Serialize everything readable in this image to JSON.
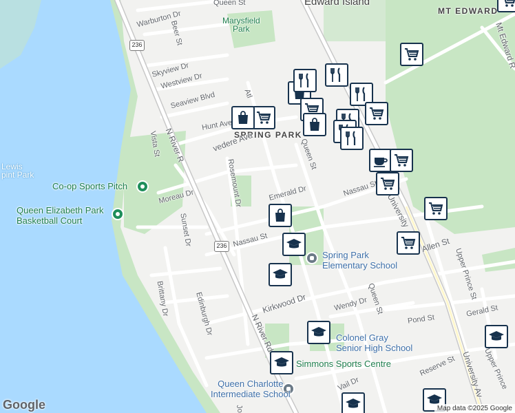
{
  "colors": {
    "water": "#aadaff",
    "park": "#c8e6c4",
    "road": "#ffffff",
    "highway": "#bcbcbc",
    "marker_border": "#17324d",
    "poi_green": "#1e7e4d",
    "poi_blue": "#3d6fa8"
  },
  "map_labels": {
    "edward_island": "Edward Island",
    "mt_edward": "MT EDWARD",
    "marysfield_park": "Marysfield\nPark",
    "spring_park": "SPRING PARK",
    "lewis_point_park": "Lewis\npint Park"
  },
  "streets": {
    "queen_top": "Queen St",
    "warburton": "Warburton Dr",
    "beer": "Beer St",
    "skyview": "Skyview Dr",
    "westview": "Westview Dr",
    "seaview": "Seaview Blvd",
    "hunt": "Hunt Ave",
    "atlantic": "Atl",
    "belvedere": "vedere Ave",
    "n_river_rd_1": "N River R",
    "vista": "Vista St",
    "rosemount": "Rosemount Dr",
    "moreau": "Moreau Dr",
    "emerald": "Emerald Dr",
    "queen_mid": "Queen St",
    "nassau_left": "Nassau St",
    "nassau_right": "Nassau St",
    "university_1": "University",
    "sunset": "Sunset Dr",
    "allen": "Allen St",
    "upper_prince_1": "Upper Prince St",
    "brittany": "Brittany Dr",
    "edinburgh": "Edinburgh Dr",
    "kirkwood": "Kirkwood Dr",
    "wendy": "Wendy Dr",
    "queen_low": "Queen St",
    "pond": "Pond St",
    "gerald": "Gerald St",
    "n_river_rd_2": "N River Rd",
    "university_2": "University Av",
    "upper_prince_2": "Upper Prince",
    "reserve": "Reserve St",
    "vail": "Vail Dr",
    "mt_edward_rd": "Mt Edward R",
    "sunset_lower": "Jo"
  },
  "route_shields": [
    "236",
    "236"
  ],
  "pois": {
    "coop": "Co-op Sports Pitch",
    "qe_park": "Queen Elizabeth Park\nBasketball Court",
    "spring_park_elem": "Spring Park\nElementary School",
    "colonel_gray": "Colonel Gray\nSenior High School",
    "simmons": "Simmons Sports Centre",
    "queen_charlotte": "Queen Charlotte\nIntermediate School"
  },
  "markers": [
    {
      "icon": "shopping-cart-icon"
    },
    {
      "icon": "shopping-cart-icon"
    },
    {
      "icon": "shopping-bag-icon"
    },
    {
      "icon": "shopping-cart-icon"
    },
    {
      "icon": "restaurant-icon"
    },
    {
      "icon": "restaurant-icon"
    },
    {
      "icon": "shopping-bag-icon"
    },
    {
      "icon": "restaurant-icon"
    },
    {
      "icon": "shopping-cart-icon"
    },
    {
      "icon": "shopping-bag-icon"
    },
    {
      "icon": "restaurant-icon"
    },
    {
      "icon": "shopping-cart-icon"
    },
    {
      "icon": "restaurant-icon"
    },
    {
      "icon": "restaurant-icon"
    },
    {
      "icon": "coffee-icon"
    },
    {
      "icon": "shopping-cart-icon"
    },
    {
      "icon": "shopping-cart-icon"
    },
    {
      "icon": "shopping-cart-icon"
    },
    {
      "icon": "shopping-cart-icon"
    },
    {
      "icon": "shopping-bag-icon"
    },
    {
      "icon": "school-icon"
    },
    {
      "icon": "school-icon"
    },
    {
      "icon": "school-icon"
    },
    {
      "icon": "school-icon"
    },
    {
      "icon": "school-icon"
    },
    {
      "icon": "school-icon"
    },
    {
      "icon": "school-icon"
    }
  ],
  "footer": {
    "logo": "Google",
    "attribution": "Map data ©2025 Google"
  }
}
